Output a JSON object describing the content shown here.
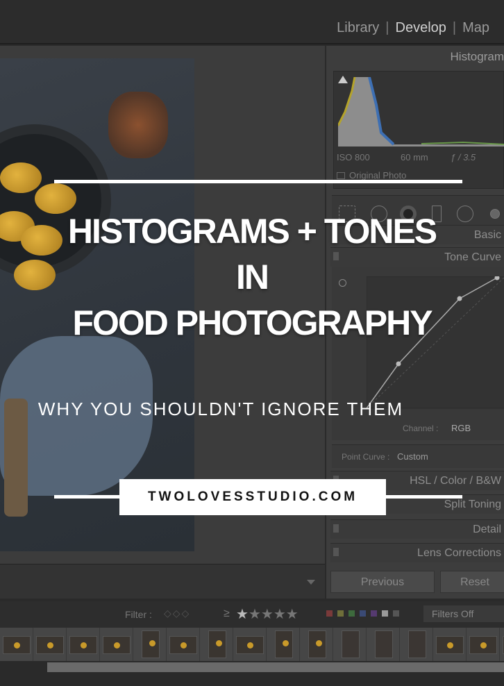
{
  "app": {
    "modules": [
      "Library",
      "Develop",
      "Map"
    ],
    "active_module": "Develop"
  },
  "right_panel": {
    "histogram_title": "Histogram",
    "iso": "ISO 800",
    "focal_length": "60 mm",
    "aperture": "ƒ / 3.5",
    "original_photo_label": "Original Photo",
    "basic_title": "Basic",
    "tone_curve_title": "Tone Curve",
    "channel_label": "Channel :",
    "channel_value": "RGB",
    "point_curve_label": "Point Curve :",
    "point_curve_value": "Custom",
    "hsl_title": "HSL / Color / B&W",
    "split_toning_title": "Split Toning",
    "detail_title": "Detail",
    "lens_title": "Lens Corrections",
    "previous_label": "Previous",
    "reset_label": "Reset"
  },
  "filter_bar": {
    "filter_label": "Filter :",
    "rating_op": "≥",
    "stars": 5,
    "color_labels": [
      "#7a3a3a",
      "#6f6f3a",
      "#3d6a3d",
      "#3a4a75",
      "#553a70",
      "#9a9a9a",
      "#555555"
    ],
    "filters_value": "Filters Off"
  },
  "filmstrip": {
    "thumbs": [
      "l",
      "l",
      "l",
      "l",
      "p",
      "l",
      "p",
      "l",
      "p",
      "p",
      "b",
      "b",
      "b",
      "l",
      "l",
      "l"
    ]
  },
  "overlay": {
    "title_line1": "HISTOGRAMS + TONES",
    "title_line2": "IN",
    "title_line3": "FOOD PHOTOGRAPHY",
    "subtitle": "WHY YOU SHOULDN'T IGNORE THEM",
    "website": "TWOLOVESSTUDIO.COM"
  }
}
